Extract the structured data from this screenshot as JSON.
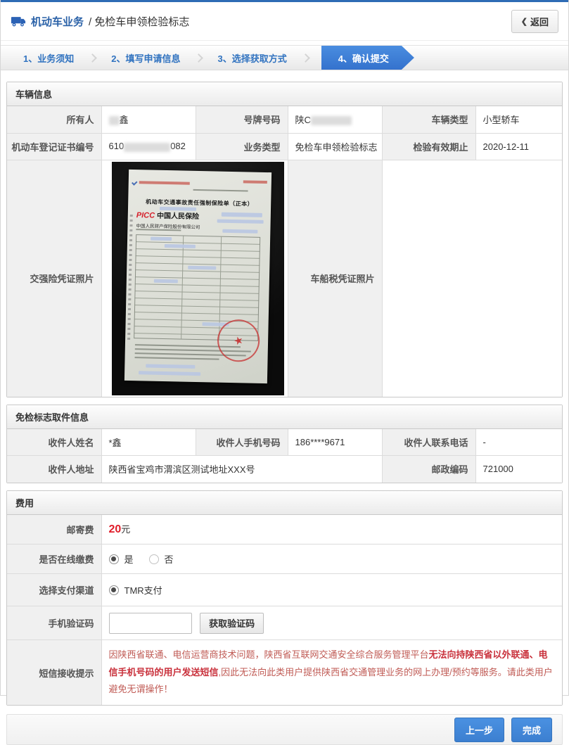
{
  "header": {
    "title_primary": "机动车业务",
    "title_secondary": "/ 免检车申领检验标志",
    "back_icon": "❮",
    "back_label": "返回"
  },
  "steps": [
    {
      "label": "1、业务须知"
    },
    {
      "label": "2、填写申请信息"
    },
    {
      "label": "3、选择获取方式"
    },
    {
      "label": "4、确认提交"
    }
  ],
  "vehicle": {
    "section_title": "车辆信息",
    "owner_label": "所有人",
    "owner_value": "鑫",
    "plate_label": "号牌号码",
    "plate_prefix": "陕C",
    "type_label": "车辆类型",
    "type_value": "小型轿车",
    "cert_label": "机动车登记证书编号",
    "cert_prefix": "610",
    "cert_suffix": "082",
    "biz_label": "业务类型",
    "biz_value": "免检车申领检验标志",
    "valid_label": "检验有效期止",
    "valid_value": "2020-12-11",
    "insurance_photo_label": "交强险凭证照片",
    "tax_photo_label": "车船税凭证照片"
  },
  "insurance_doc": {
    "title": "机动车交通事故责任强制保险单（正本）",
    "brand": "PICC",
    "brand_cn": "中国人民保险",
    "company": "中国人民财产保险股份有限公司",
    "stamp_star": "★"
  },
  "pickup": {
    "section_title": "免检标志取件信息",
    "name_label": "收件人姓名",
    "name_value": "*鑫",
    "mobile_label": "收件人手机号码",
    "mobile_value": "186****9671",
    "phone_label": "收件人联系电话",
    "phone_value": "-",
    "address_label": "收件人地址",
    "address_value": "陕西省宝鸡市渭滨区测试地址XXX号",
    "zip_label": "邮政编码",
    "zip_value": "721000"
  },
  "fee": {
    "section_title": "费用",
    "postage_label": "邮寄费",
    "postage_amount": "20",
    "postage_unit": "元",
    "online_label": "是否在线缴费",
    "online_yes": "是",
    "online_no": "否",
    "channel_label": "选择支付渠道",
    "channel_value": "TMR支付",
    "code_label": "手机验证码",
    "get_code": "获取验证码",
    "sms_label": "短信接收提示",
    "sms_part1": "因陕西省联通、电信运营商技术问题，陕西省互联网交通安全综合服务管理平台",
    "sms_bold": "无法向持陕西省以外联通、电信手机号码的用户发送短信",
    "sms_part2": ",因此无法向此类用户提供陕西省交通管理业务的网上办理/预约等服务。请此类用户避免无谓操作！"
  },
  "footer": {
    "prev": "上一步",
    "done": "完成"
  }
}
